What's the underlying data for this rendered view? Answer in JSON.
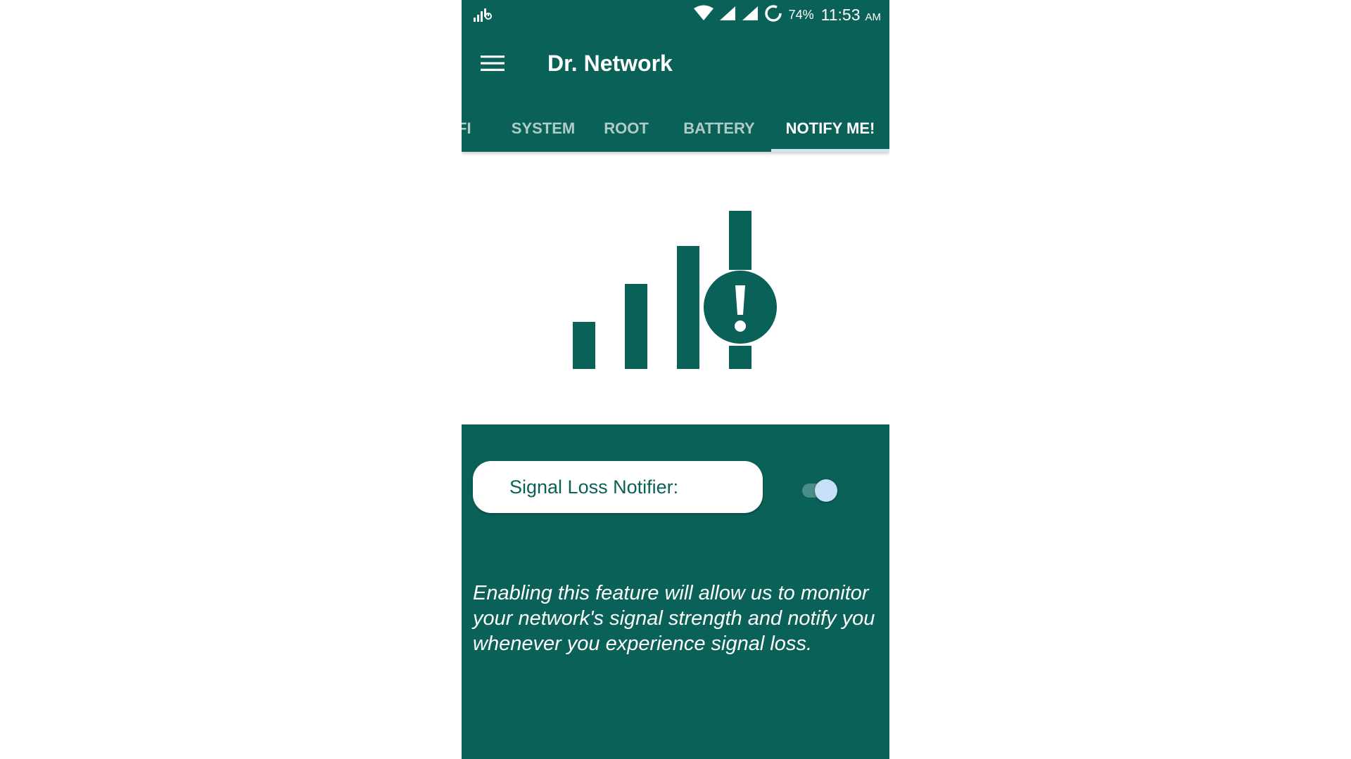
{
  "status_bar": {
    "battery_percent": "74%",
    "time": "11:53",
    "ampm": "AM",
    "icons": [
      "network-activity-icon",
      "wifi-icon",
      "cell-signal-icon",
      "cell-signal-icon",
      "sync-icon"
    ]
  },
  "app_bar": {
    "title": "Dr. Network",
    "menu_icon": "hamburger-menu-icon"
  },
  "tabs": [
    {
      "label": "FI",
      "active": false
    },
    {
      "label": "SYSTEM",
      "active": false
    },
    {
      "label": "ROOT",
      "active": false
    },
    {
      "label": "BATTERY",
      "active": false
    },
    {
      "label": "NOTIFY ME!",
      "active": true
    }
  ],
  "hero": {
    "icon": "signal-loss-alert-icon",
    "alert_glyph": "!"
  },
  "notifier": {
    "label": "Signal Loss Notifier:",
    "enabled": true
  },
  "description": "Enabling this feature will allow us to monitor your network's signal strength and notify you whenever you experience signal loss.",
  "colors": {
    "primary": "#0a6157",
    "tab_indicator": "#cfe6f5",
    "switch_thumb": "#c6e0f7",
    "background": "#ffffff"
  }
}
